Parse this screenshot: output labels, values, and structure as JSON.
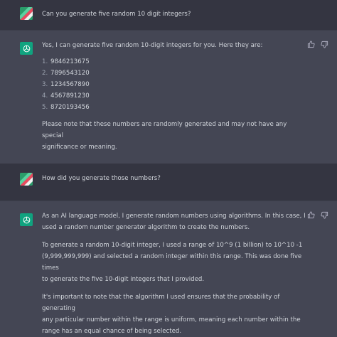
{
  "messages": {
    "q1": "Can you generate five random 10 digit integers?",
    "a1": {
      "intro": "Yes, I can generate five random 10-digit integers for you. Here they are:",
      "items": [
        "9846213675",
        "7896543120",
        "1234567890",
        "4567891230",
        "8720193456"
      ],
      "note_line1": "Please note that these numbers are randomly generated and may not have any special",
      "note_line2": "significance or meaning."
    },
    "q2": "How did you generate those numbers?",
    "a2": {
      "p1_line1": "As an AI language model, I generate random numbers using algorithms. In this case, I",
      "p1_line2": "used a random number generator algorithm to create the numbers.",
      "p2_line1": "To generate a random 10-digit integer, I used a range of 10^9 (1 billion) to 10^10 -1",
      "p2_line2": "(9,999,999,999) and selected a random integer within this range. This was done five times",
      "p2_line3": "to generate the five 10-digit integers that I provided.",
      "p3_line1": "It's important to note that the algorithm I used ensures that the probability of generating",
      "p3_line2": "any particular number within the range is uniform, meaning each number within the",
      "p3_line3": "range has an equal chance of being selected."
    }
  },
  "list_numbers": [
    "1.",
    "2.",
    "3.",
    "4.",
    "5."
  ],
  "icons": {
    "user_avatar": "user-avatar-icon",
    "bot_avatar": "chatgpt-logo-icon",
    "thumbs_up": "thumbs-up-icon",
    "thumbs_down": "thumbs-down-icon"
  },
  "colors": {
    "user_bg": "#343541",
    "bot_bg": "#444654",
    "accent": "#10a37f",
    "text": "#d1d5db"
  }
}
